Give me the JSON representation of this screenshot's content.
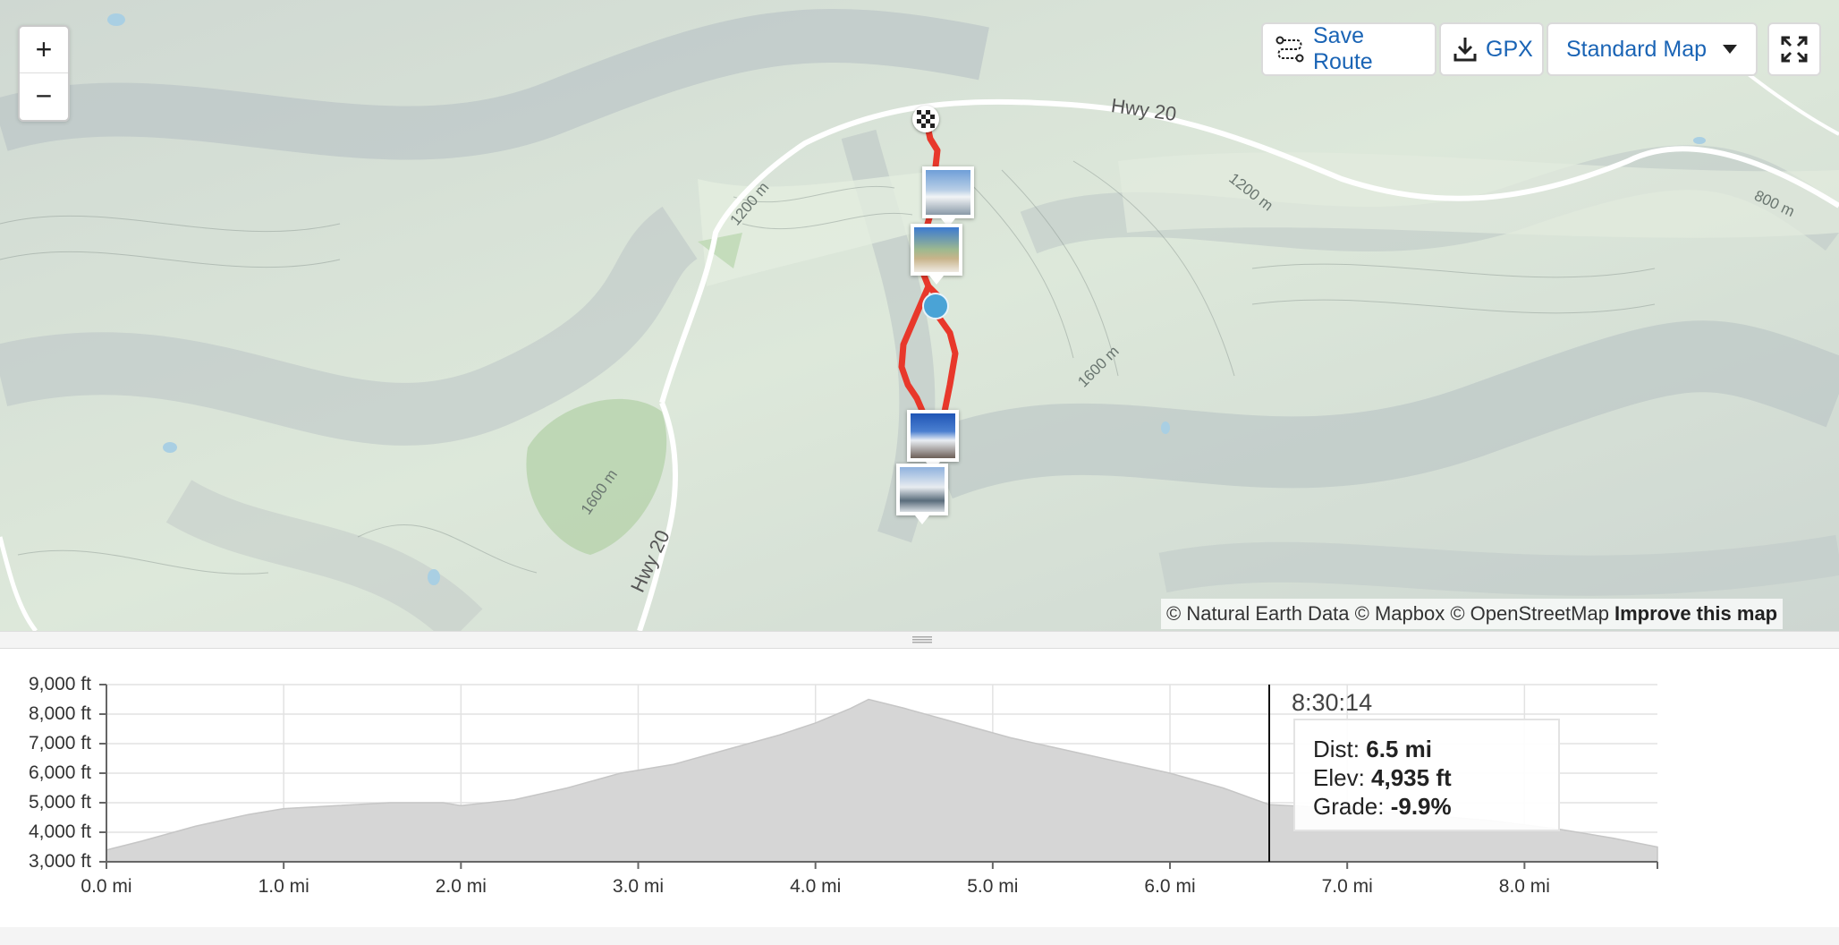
{
  "map": {
    "zoom_in_label": "+",
    "zoom_out_label": "−",
    "toolbar": {
      "save_route_label": "Save Route",
      "gpx_label": "GPX",
      "map_style_label": "Standard Map"
    },
    "labels": {
      "hwy20_top": "Hwy 20",
      "hwy20_left": "Hwy 20",
      "contour_1200_left": "1200 m",
      "contour_1200_right": "1200 m",
      "contour_800": "800 m",
      "contour_1600_center": "1600 m",
      "contour_1600_left": "1600 m"
    },
    "attribution": {
      "text": "© Natural Earth Data © Mapbox © OpenStreetMap",
      "link": "Improve this map"
    },
    "icons": [
      "plus-icon",
      "minus-icon",
      "route-icon",
      "download-icon",
      "caret-down-icon",
      "fullscreen-icon",
      "checkered-flag-icon"
    ],
    "route_color": "#e8382b"
  },
  "profile": {
    "y_ticks": [
      "9,000 ft",
      "8,000 ft",
      "7,000 ft",
      "6,000 ft",
      "5,000 ft",
      "4,000 ft",
      "3,000 ft"
    ],
    "x_ticks": [
      "0.0 mi",
      "1.0 mi",
      "2.0 mi",
      "3.0 mi",
      "4.0 mi",
      "5.0 mi",
      "6.0 mi",
      "7.0 mi",
      "8.0 mi"
    ],
    "cursor_time": "8:30:14",
    "tooltip": {
      "dist_label": "Dist: ",
      "dist_value": "6.5 mi",
      "elev_label": "Elev: ",
      "elev_value": "4,935 ft",
      "grade_label": "Grade: ",
      "grade_value": "-9.9%"
    }
  },
  "chart_data": {
    "type": "area",
    "title": "",
    "xlabel": "",
    "ylabel": "",
    "x_unit": "mi",
    "y_unit": "ft",
    "xlim": [
      0,
      8.75
    ],
    "ylim": [
      3000,
      9000
    ],
    "grid": true,
    "cursor_x": 6.56,
    "x": [
      0.0,
      0.2,
      0.5,
      0.8,
      1.0,
      1.3,
      1.6,
      1.9,
      2.0,
      2.3,
      2.6,
      2.9,
      3.2,
      3.5,
      3.8,
      4.0,
      4.2,
      4.3,
      4.5,
      4.8,
      5.1,
      5.4,
      5.7,
      6.0,
      6.3,
      6.56,
      7.0,
      7.4,
      7.8,
      8.2,
      8.5,
      8.75
    ],
    "y": [
      3400,
      3700,
      4200,
      4600,
      4800,
      4900,
      5000,
      5000,
      4900,
      5100,
      5500,
      6000,
      6300,
      6800,
      7300,
      7700,
      8200,
      8500,
      8200,
      7700,
      7200,
      6800,
      6400,
      6000,
      5500,
      4935,
      4800,
      4600,
      4400,
      4100,
      3800,
      3500
    ]
  }
}
